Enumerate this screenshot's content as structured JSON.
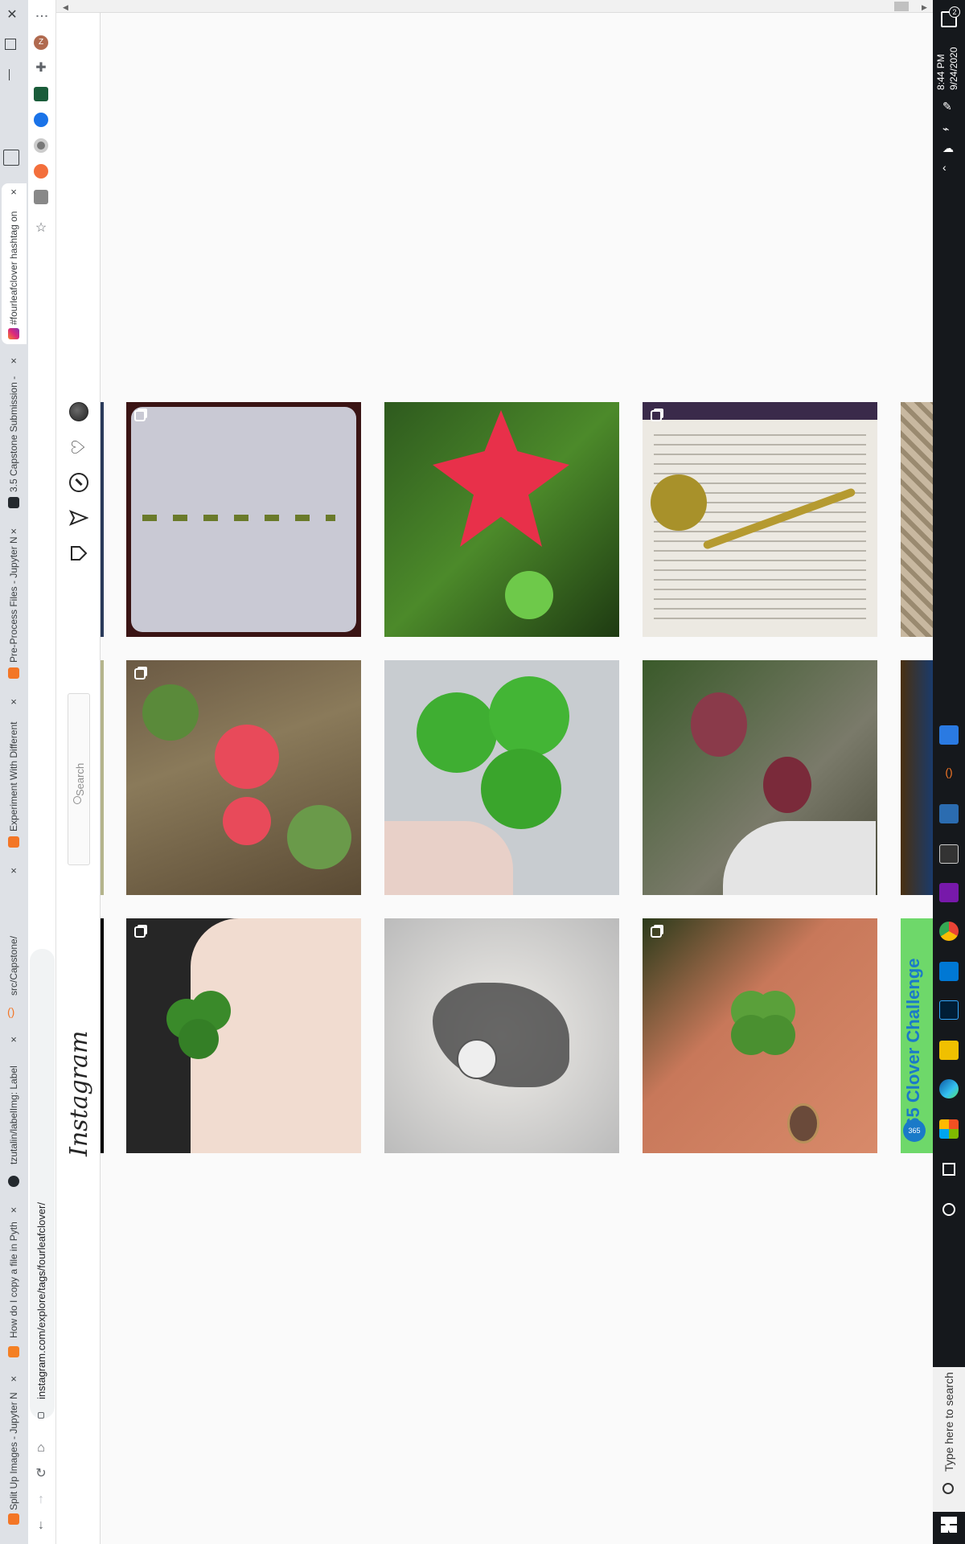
{
  "browser": {
    "tabs": [
      {
        "label": "#fourleafclover hashtag on",
        "active": true
      },
      {
        "label": "3.5 Capstone Submission -"
      },
      {
        "label": "Pre-Process Files - Jupyter N"
      },
      {
        "label": "Experiment With Different"
      },
      {
        "label": "src/Capstone/"
      },
      {
        "label": "tzutalin/labelImg: Label"
      },
      {
        "label": "How do I copy a file in Pyth"
      },
      {
        "label": "Split Up Images - Jupyter N"
      }
    ],
    "close_glyph": "×",
    "address": "instagram.com/explore/tags/fourleafclover/",
    "profile_initial": "Z",
    "menu_glyph": "⋮"
  },
  "instagram": {
    "logo": "Instagram",
    "search_placeholder": "Search",
    "nav_icons": [
      "home-icon",
      "direct-icon",
      "explore-icon",
      "activity-icon",
      "profile-avatar"
    ]
  },
  "posts": [
    {
      "row": 0,
      "col": 0,
      "subject": "crochet clover chain",
      "multi": true
    },
    {
      "row": 0,
      "col": 1,
      "subject": "red maple leaf and clover",
      "multi": false
    },
    {
      "row": 0,
      "col": 2,
      "subject": "crochet clover bookmark",
      "multi": true
    },
    {
      "row": 1,
      "col": 0,
      "subject": "pink oxalis flower",
      "multi": true
    },
    {
      "row": 1,
      "col": 1,
      "subject": "hand holding clover",
      "multi": false
    },
    {
      "row": 1,
      "col": 2,
      "subject": "purple oxalis",
      "multi": false
    },
    {
      "row": 2,
      "col": 0,
      "subject": "fingers holding clover",
      "multi": true
    },
    {
      "row": 2,
      "col": 1,
      "subject": "manga drawing",
      "multi": false
    },
    {
      "row": 2,
      "col": 2,
      "subject": "clover on ring hand",
      "multi": true
    }
  ],
  "partial_post_text": {
    "badge": "365",
    "caption": "365 Clover Challenge"
  },
  "taskbar": {
    "search_placeholder": "Type here to search",
    "time": "8:44 PM",
    "date": "9/24/2020",
    "notification_count": "2"
  },
  "colors": {
    "accent": "#e1306c",
    "taskbar": "#15181c",
    "clover": "#3a8a2a"
  }
}
